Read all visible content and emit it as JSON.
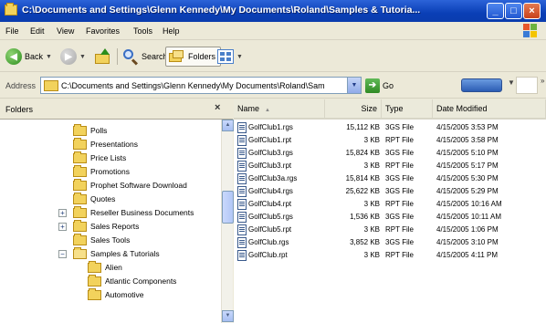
{
  "window": {
    "title": "C:\\Documents and Settings\\Glenn Kennedy\\My Documents\\Roland\\Samples & Tutoria...",
    "min_label": "_",
    "max_label": "□",
    "close_label": "×"
  },
  "menu": [
    "File",
    "Edit",
    "View",
    "Favorites",
    "Tools",
    "Help"
  ],
  "toolbar": {
    "back_label": "Back",
    "search_label": "Search",
    "folders_label": "Folders"
  },
  "address": {
    "label": "Address",
    "value": "C:\\Documents and Settings\\Glenn Kennedy\\My Documents\\Roland\\Sam",
    "go_label": "Go"
  },
  "folders_pane": {
    "title": "Folders",
    "close_label": "×",
    "items": [
      {
        "label": "Polls",
        "expander": ""
      },
      {
        "label": "Presentations",
        "expander": ""
      },
      {
        "label": "Price Lists",
        "expander": ""
      },
      {
        "label": "Promotions",
        "expander": ""
      },
      {
        "label": "Prophet Software Download",
        "expander": ""
      },
      {
        "label": "Quotes",
        "expander": ""
      },
      {
        "label": "Reseller Business Documents",
        "expander": "+"
      },
      {
        "label": "Sales Reports",
        "expander": "+"
      },
      {
        "label": "Sales Tools",
        "expander": ""
      },
      {
        "label": "Samples & Tutorials",
        "expander": "−"
      },
      {
        "label": "Alien",
        "expander": ""
      },
      {
        "label": "Atlantic Components",
        "expander": ""
      },
      {
        "label": "Automotive",
        "expander": ""
      }
    ]
  },
  "filelist": {
    "columns": {
      "name": "Name",
      "size": "Size",
      "type": "Type",
      "date": "Date Modified"
    },
    "rows": [
      {
        "name": "GolfClub1.rgs",
        "size": "15,112 KB",
        "type": "3GS File",
        "date": "4/15/2005 3:53 PM"
      },
      {
        "name": "GolfClub1.rpt",
        "size": "3 KB",
        "type": "RPT File",
        "date": "4/15/2005 3:58 PM"
      },
      {
        "name": "GolfClub3.rgs",
        "size": "15,824 KB",
        "type": "3GS File",
        "date": "4/15/2005 5:10 PM"
      },
      {
        "name": "GolfClub3.rpt",
        "size": "3 KB",
        "type": "RPT File",
        "date": "4/15/2005 5:17 PM"
      },
      {
        "name": "GolfClub3a.rgs",
        "size": "15,814 KB",
        "type": "3GS File",
        "date": "4/15/2005 5:30 PM"
      },
      {
        "name": "GolfClub4.rgs",
        "size": "25,622 KB",
        "type": "3GS File",
        "date": "4/15/2005 5:29 PM"
      },
      {
        "name": "GolfClub4.rpt",
        "size": "3 KB",
        "type": "RPT File",
        "date": "4/15/2005 10:16 AM"
      },
      {
        "name": "GolfClub5.rgs",
        "size": "1,536 KB",
        "type": "3GS File",
        "date": "4/15/2005 10:11 AM"
      },
      {
        "name": "GolfClub5.rpt",
        "size": "3 KB",
        "type": "RPT File",
        "date": "4/15/2005 1:06 PM"
      },
      {
        "name": "GolfClub.rgs",
        "size": "3,852 KB",
        "type": "3GS File",
        "date": "4/15/2005 3:10 PM"
      },
      {
        "name": "GolfClub.rpt",
        "size": "3 KB",
        "type": "RPT File",
        "date": "4/15/2005 4:11 PM"
      }
    ]
  }
}
